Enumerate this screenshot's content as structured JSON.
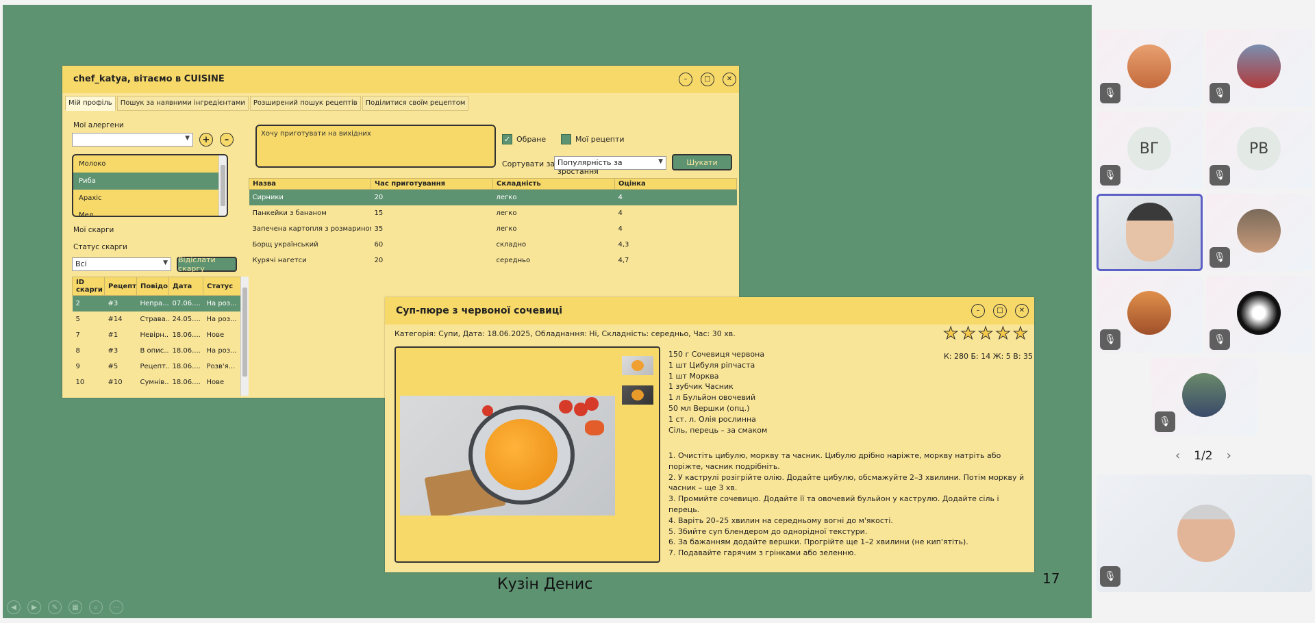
{
  "app": {
    "title": "chef_katya, вітаємо в CUISINE",
    "tabs": [
      "Мій профіль",
      "Пошук за наявними інгредієнтами",
      "Розширений пошук рецептів",
      "Поділитися своїм рецептом"
    ],
    "allergens_label": "Мої алергени",
    "allergen_options": [
      "Молоко",
      "Риба",
      "Арахіс",
      "Мед"
    ],
    "selected_allergen_index": 1,
    "complaints_label": "Мої скарги",
    "complaint_status_label": "Статус скарги",
    "complaint_status_value": "Всі",
    "send_complaint_label": "Відіслати скаргу",
    "complaints_headers": [
      "ID скарги",
      "Рецепт",
      "Повідо",
      "Дата",
      "Статус"
    ],
    "complaints_rows": [
      [
        "2",
        "#3",
        "Непра...",
        "07.06....",
        "На роз..."
      ],
      [
        "5",
        "#14",
        "Страва...",
        "24.05....",
        "На роз..."
      ],
      [
        "7",
        "#1",
        "Невірн...",
        "18.06....",
        "Нове"
      ],
      [
        "8",
        "#3",
        "В опис...",
        "18.06....",
        "На роз..."
      ],
      [
        "9",
        "#5",
        "Рецепт...",
        "18.06....",
        "Розв'я..."
      ],
      [
        "10",
        "#10",
        "Сумнів...",
        "18.06....",
        "Нове"
      ]
    ],
    "note_placeholder": "Хочу приготувати на вихідних",
    "favorites_label": "Обране",
    "my_recipes_label": "Мої рецепти",
    "sort_label": "Сортувати за",
    "sort_value": "Популярність за зростання",
    "search_label": "Шукати",
    "recipe_headers": [
      "Назва",
      "Час приготування",
      "Складність",
      "Оцінка"
    ],
    "recipe_rows": [
      [
        "Сирники",
        "20",
        "легко",
        "4"
      ],
      [
        "Панкейки з бананом",
        "15",
        "легко",
        "4"
      ],
      [
        "Запечена картопля з розмарином",
        "35",
        "легко",
        "4"
      ],
      [
        "Борщ український",
        "60",
        "складно",
        "4,3"
      ],
      [
        "Курячі нагетси",
        "20",
        "середньо",
        "4,7"
      ]
    ]
  },
  "recipe": {
    "title": "Суп-пюре з червоної сочевиці",
    "meta": "Категорія: Супи, Дата: 18.06.2025, Обладнання: Ні, Складність: середньо, Час: 30 хв.",
    "rating_stars": 5,
    "nutrition": "К: 280 Б: 14 Ж: 5 В: 35",
    "ingredients": [
      "150 г Сочевиця червона",
      "1 шт Цибуля ріпчаста",
      "1 шт Морква",
      "1 зубчик Часник",
      "1 л Бульйон овочевий",
      "50 мл Вершки (опц.)",
      "1 ст. л. Олія рослинна",
      "Сіль, перець – за смаком"
    ],
    "steps": [
      "1. Очистіть цибулю, моркву та часник. Цибулю дрібно наріжте, моркву натріть або поріжте, часник подрібніть.",
      "2. У каструлі розігрійте олію. Додайте цибулю, обсмажуйте 2–3 хвилини. Потім моркву й часник – ще 3 хв.",
      "3. Промийте сочевицю. Додайте її та овочевий бульйон у каструлю. Додайте сіль і перець.",
      "4. Варіть 20–25 хвилин на середньому вогні до м'якості.",
      "5. Збийте суп блендером до однорідної текстури.",
      "6. За бажанням додайте вершки. Прогрійте ще 1–2 хвилини (не кип'ятіть).",
      "7. Подавайте гарячим з грінками або зеленню."
    ]
  },
  "slide": {
    "author": "Кузін Денис",
    "number": "17"
  },
  "meeting": {
    "initials": [
      "ВГ",
      "РВ"
    ],
    "pager": "1/2"
  },
  "colors": {
    "slide_bg": "#5e9372",
    "window_bg": "#f9e598",
    "title_bar": "#f7d96a",
    "accent_green": "#5e9372"
  }
}
